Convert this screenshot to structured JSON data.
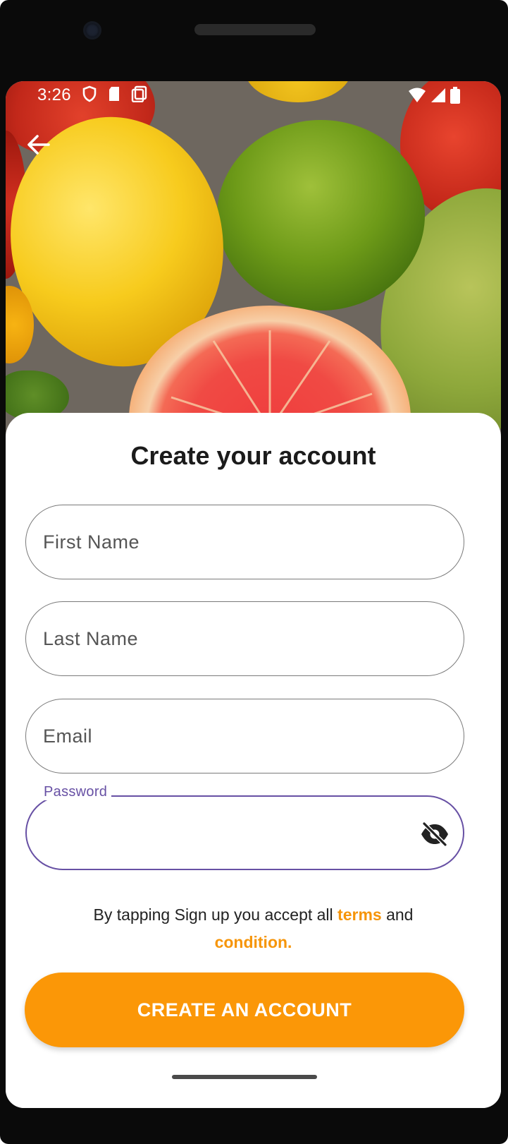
{
  "status_bar": {
    "time": "3:26",
    "left_icons": [
      "shield-icon",
      "sd-card-icon",
      "screenshot-icon"
    ],
    "right_icons": [
      "wifi-icon",
      "signal-icon",
      "battery-icon"
    ]
  },
  "hero": {
    "image": "fruit-background-image",
    "back_icon": "back-arrow-icon"
  },
  "form": {
    "title": "Create your account",
    "first_name": {
      "placeholder": "First Name",
      "value": ""
    },
    "last_name": {
      "placeholder": "Last Name",
      "value": ""
    },
    "email": {
      "placeholder": "Email",
      "value": ""
    },
    "password": {
      "label": "Password",
      "value": "",
      "toggle_icon": "visibility-off-icon"
    },
    "terms": {
      "prefix": "By tapping Sign up you accept all ",
      "link_terms": "terms",
      "middle": " and ",
      "link_condition": "condition."
    },
    "submit_label": "CREATE AN ACCOUNT"
  },
  "colors": {
    "accent": "#fb9707",
    "link": "#f6950a",
    "focus": "#6750a4"
  }
}
